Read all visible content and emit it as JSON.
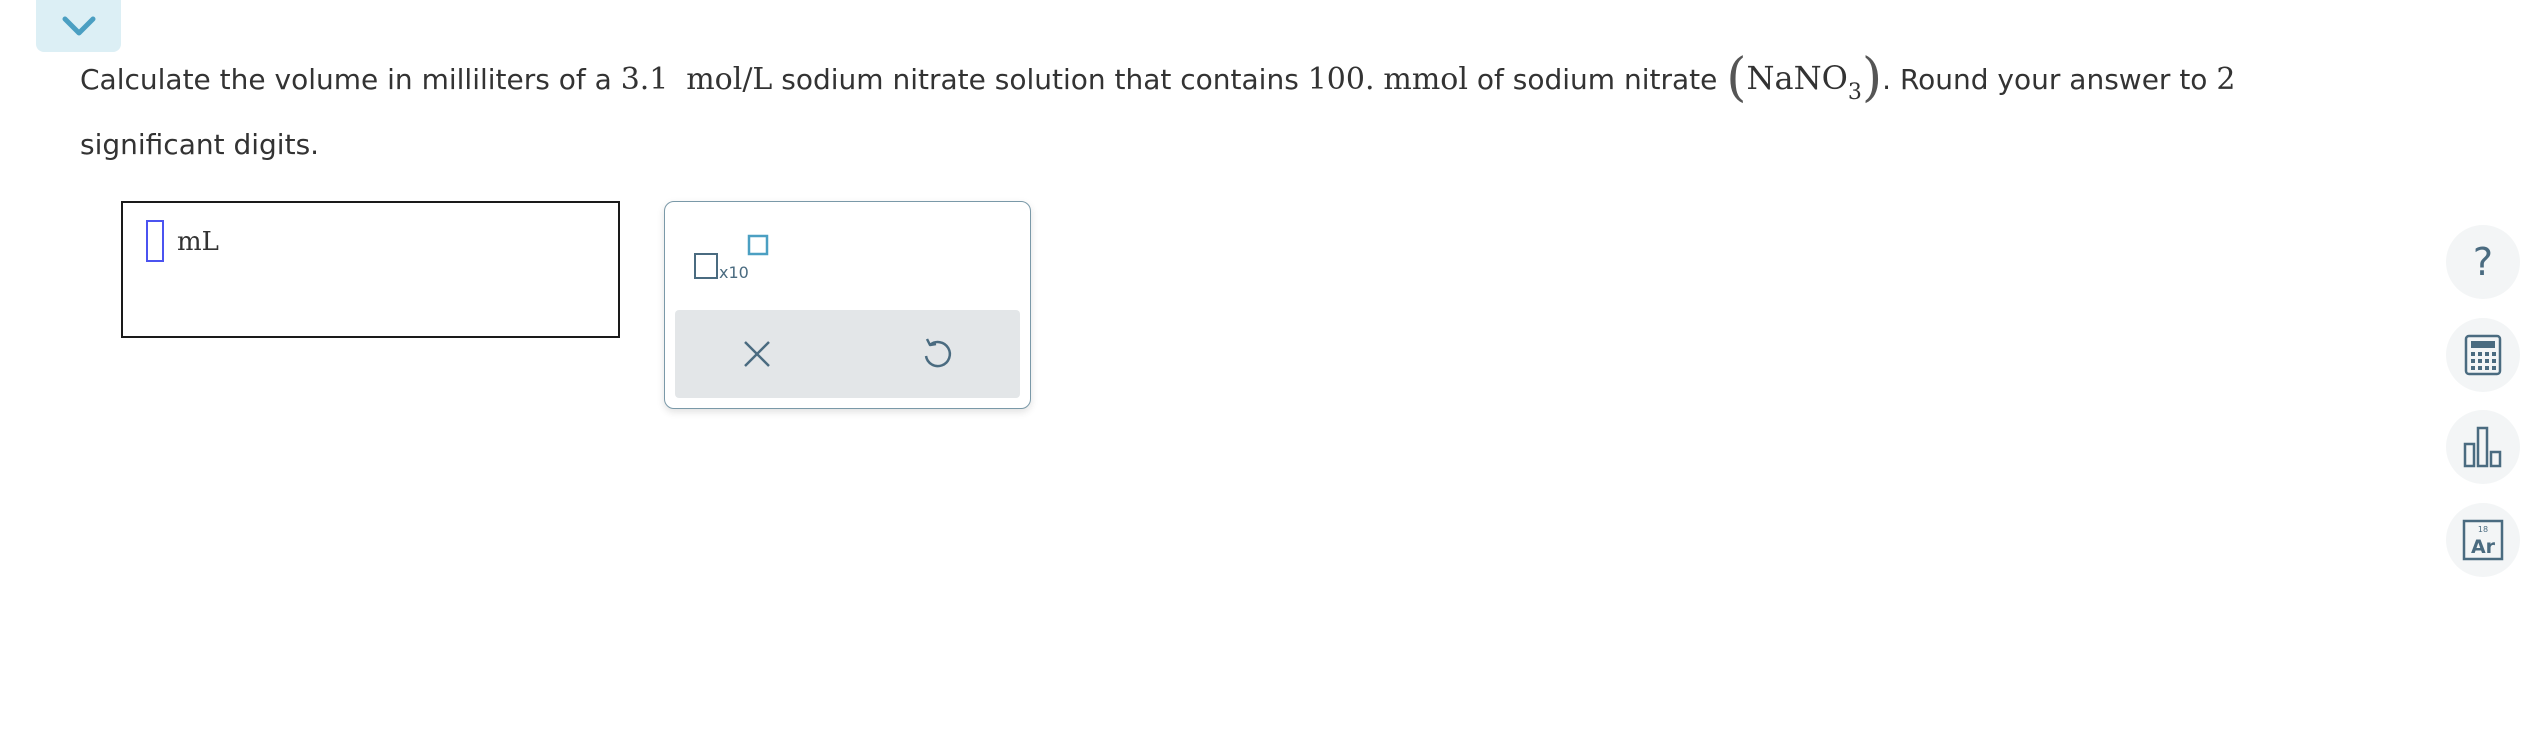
{
  "question": {
    "part1": "Calculate the volume in milliliters of a ",
    "molarity_value": "3.1",
    "molarity_unit": "mol/L",
    "part2": " sodium nitrate solution that contains ",
    "amount_value": "100.",
    "amount_unit": "mmol",
    "part3": " of sodium nitrate ",
    "paren_open": "(",
    "formula_main": "NaNO",
    "formula_sub": "3",
    "paren_close": ")",
    "part4": ". Round your answer to ",
    "sig_digits": "2",
    "part5": "significant digits."
  },
  "answer": {
    "value": "",
    "unit": "mL"
  },
  "toolpanel": {
    "x10_label": "x10"
  },
  "sidebar": {
    "help_label": "?",
    "periodic_number": "18",
    "periodic_symbol": "Ar"
  },
  "colors": {
    "accent": "#4b9fc2",
    "tab_bg": "#dceff5",
    "cursor": "#4b53f0",
    "icon": "#4a6b80"
  }
}
